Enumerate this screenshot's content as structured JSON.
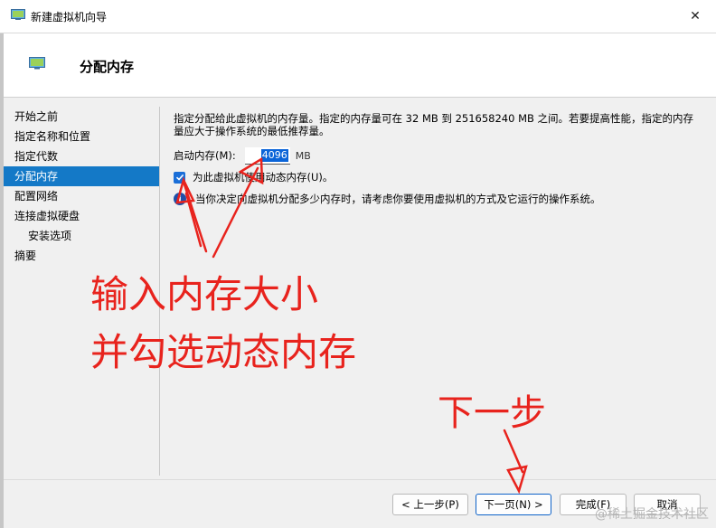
{
  "window": {
    "title": "新建虚拟机向导",
    "close_glyph": "✕"
  },
  "header": {
    "title": "分配内存"
  },
  "nav": {
    "items": [
      {
        "label": "开始之前",
        "active": false,
        "sub": false
      },
      {
        "label": "指定名称和位置",
        "active": false,
        "sub": false
      },
      {
        "label": "指定代数",
        "active": false,
        "sub": false
      },
      {
        "label": "分配内存",
        "active": true,
        "sub": false
      },
      {
        "label": "配置网络",
        "active": false,
        "sub": false
      },
      {
        "label": "连接虚拟硬盘",
        "active": false,
        "sub": false
      },
      {
        "label": "安装选项",
        "active": false,
        "sub": true
      },
      {
        "label": "摘要",
        "active": false,
        "sub": false
      }
    ]
  },
  "content": {
    "description_line1": "指定分配给此虚拟机的内存量。指定的内存量可在 32 MB 到 251658240 MB 之间。若要提高性能，指定的内存",
    "description_line2": "量应大于操作系统的最低推荐量。",
    "startup_memory_label": "启动内存(M):",
    "startup_memory_value": "4096",
    "memory_unit": "MB",
    "dynamic_memory_label": "为此虚拟机使用动态内存(U)。",
    "dynamic_memory_checked": true,
    "info_text": "当你决定向虚拟机分配多少内存时，请考虑你要使用虚拟机的方式及它运行的操作系统。"
  },
  "buttons": {
    "previous": "< 上一步(P)",
    "next": "下一页(N) >",
    "finish": "完成(F)",
    "cancel": "取消"
  },
  "annotations": {
    "line1": "输入内存大小",
    "line2": "并勾选动态内存",
    "next_step": "下一步"
  },
  "watermark": "@稀土掘金技术社区",
  "colors": {
    "accent": "#1479c7",
    "annotation": "#e8231d"
  }
}
